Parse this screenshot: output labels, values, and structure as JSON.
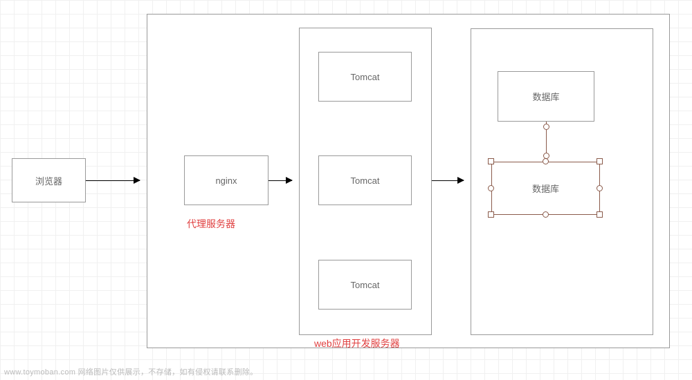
{
  "diagram": {
    "browser": "浏览器",
    "nginx": "nginx",
    "proxy_label": "代理服务器",
    "tomcat_group": {
      "items": [
        "Tomcat",
        "Tomcat",
        "Tomcat"
      ],
      "label": "web应用开发服务器"
    },
    "database_group": {
      "db1": "数据库",
      "db2": "数据库"
    }
  },
  "watermark": "www.toymoban.com  网络图片仅供展示，不存储，如有侵权请联系删除。"
}
